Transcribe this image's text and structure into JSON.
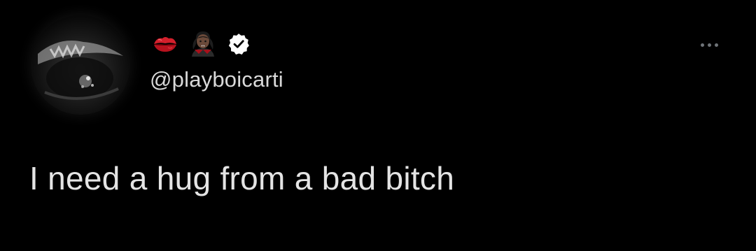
{
  "tweet": {
    "author": {
      "display_name_icons": [
        "kiss-mark-icon",
        "vampire-icon"
      ],
      "verified": true,
      "handle": "@playboicarti"
    },
    "text": "I need a hug from a bad bitch",
    "more_menu_icon": "ellipsis-icon"
  },
  "colors": {
    "background": "#000000",
    "text": "#e4e4e4",
    "handle": "#d9d9d9",
    "verified_badge": "#ffffff",
    "more_dots": "#6e7378"
  }
}
